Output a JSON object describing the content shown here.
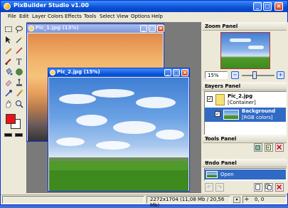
{
  "app": {
    "title": "PixBuilder Studio v1.00"
  },
  "titlebar_buttons": {
    "minimize": "_",
    "maximize": "□",
    "close": "×"
  },
  "menu": [
    "File",
    "Edit",
    "Layer",
    "Colors",
    "Effects",
    "Tools",
    "Select",
    "View",
    "Options",
    "Help"
  ],
  "tools": [
    "marquee-rect",
    "lasso",
    "move",
    "wand",
    "pencil",
    "line",
    "brush",
    "text",
    "bucket",
    "gradient",
    "eraser",
    "clone",
    "eyedropper",
    "burn",
    "hand",
    "zoom"
  ],
  "colors": {
    "foreground": "#e8141a",
    "background": "#ffffff"
  },
  "documents": [
    {
      "title": "Pic_1.jpg (13%)",
      "active": false
    },
    {
      "title": "Pic_2.jpg (15%)",
      "active": true
    }
  ],
  "zoom_panel": {
    "title": "Zoom Panel",
    "zoom_value": "15%",
    "minus": "−",
    "plus": "+",
    "slider": 0.35
  },
  "layers_panel": {
    "title": "Layers Panel",
    "layers": [
      {
        "name": "Pic_2.jpg",
        "info": "[Container]",
        "selected": false
      },
      {
        "name": "Background",
        "info": "[RGB colors]",
        "selected": true
      }
    ]
  },
  "tools_panel": {
    "title": "Tools Panel"
  },
  "undo_panel": {
    "title": "Undo Panel",
    "items": [
      "Open"
    ]
  },
  "status": {
    "dimensions": "2272x1704 (11,08 Mb / 20,56 Mb)",
    "coords": "0, 0"
  }
}
